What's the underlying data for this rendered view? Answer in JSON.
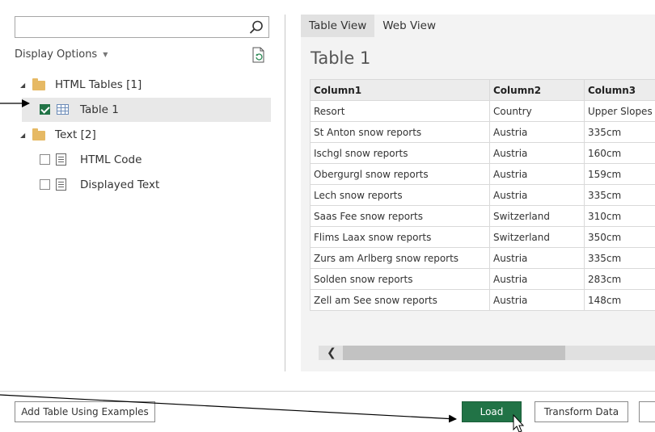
{
  "navigator": {
    "search": {
      "value": "",
      "placeholder": ""
    },
    "display_options": "Display Options",
    "tree": [
      {
        "label": "HTML Tables [1]",
        "type": "folder",
        "expanded": true
      },
      {
        "label": "Table 1",
        "type": "table",
        "checked": true,
        "selected": true
      },
      {
        "label": "Text [2]",
        "type": "folder",
        "expanded": true
      },
      {
        "label": "HTML Code",
        "type": "text",
        "checked": false
      },
      {
        "label": "Displayed Text",
        "type": "text",
        "checked": false
      }
    ]
  },
  "preview": {
    "tabs": [
      "Table View",
      "Web View"
    ],
    "active_tab": "Table View",
    "title": "Table 1",
    "columns": [
      "Column1",
      "Column2",
      "Column3"
    ],
    "rows": [
      [
        "Resort",
        "Country",
        "Upper Slopes"
      ],
      [
        "St Anton snow reports",
        "Austria",
        "335cm"
      ],
      [
        "Ischgl snow reports",
        "Austria",
        "160cm"
      ],
      [
        "Obergurgl snow reports",
        "Austria",
        "159cm"
      ],
      [
        "Lech snow reports",
        "Austria",
        "335cm"
      ],
      [
        "Saas Fee snow reports",
        "Switzerland",
        "310cm"
      ],
      [
        "Flims Laax snow reports",
        "Switzerland",
        "350cm"
      ],
      [
        "Zurs am Arlberg snow reports",
        "Austria",
        "335cm"
      ],
      [
        "Solden snow reports",
        "Austria",
        "283cm"
      ],
      [
        "Zell am See snow reports",
        "Austria",
        "148cm"
      ]
    ],
    "scroll_left_glyph": "❮"
  },
  "footer": {
    "add_table_label": "Add Table Using Examples",
    "load_label": "Load",
    "transform_label": "Transform Data",
    "cancel_label": ""
  },
  "colors": {
    "accent_green": "#217346",
    "folder_yellow": "#e6b964",
    "panel_bg": "#f3f3f3"
  }
}
